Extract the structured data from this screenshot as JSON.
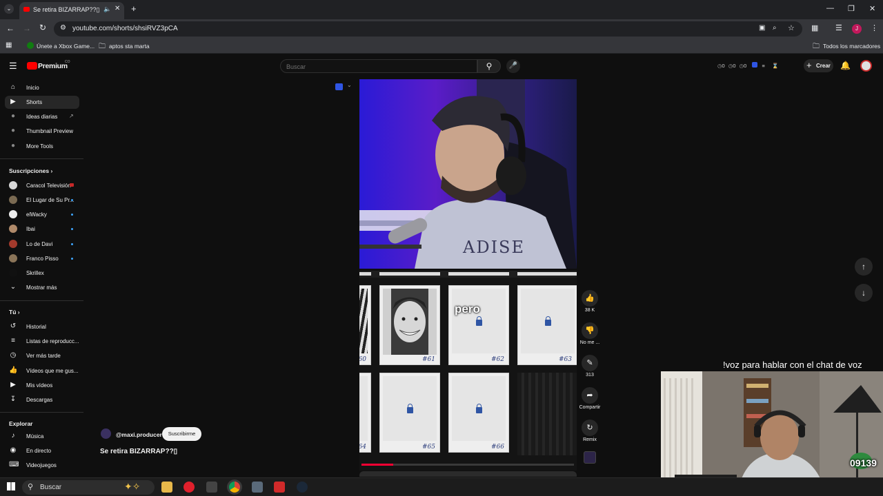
{
  "browser": {
    "tab_title": "Se retira BIZARRAP??▯ - Yo",
    "new_tab": "+",
    "url": "youtube.com/shorts/shsiRVZ3pCA",
    "bookmarks": [
      "Únete a Xbox Game...",
      "aptos sta marta"
    ],
    "all_bookmarks": "Todos los marcadores",
    "profile_initial": "J"
  },
  "youtube": {
    "logo": "Premium",
    "logo_sup": "CO",
    "search_placeholder": "Buscar",
    "create_label": "Crear",
    "stats": [
      "0",
      "0",
      "0"
    ]
  },
  "sidebar": {
    "main": [
      {
        "label": "Inicio",
        "icon": "home-icon"
      },
      {
        "label": "Shorts",
        "icon": "shorts-icon"
      },
      {
        "label": "Ideas diarias",
        "icon": "extension-icon"
      },
      {
        "label": "Thumbnail Preview",
        "icon": "extension-icon"
      },
      {
        "label": "More Tools",
        "icon": "extension-icon"
      }
    ],
    "subs_header": "Suscripciones",
    "subs": [
      {
        "label": "Caracol Televisión",
        "color": "#d8d8d8"
      },
      {
        "label": "El Lugar de Su Pr...",
        "color": "#7a6a52"
      },
      {
        "label": "elWacky",
        "color": "#eeeeee"
      },
      {
        "label": "Ibai",
        "color": "#b08a6a"
      },
      {
        "label": "Lo de Davi",
        "color": "#a33a2c"
      },
      {
        "label": "Franco Pisso",
        "color": "#8a7458"
      },
      {
        "label": "Skrillex",
        "color": "#111111"
      }
    ],
    "show_more": "Mostrar más",
    "you_header": "Tú",
    "you": [
      {
        "label": "Historial",
        "icon": "history-icon"
      },
      {
        "label": "Listas de reproducc...",
        "icon": "playlist-icon"
      },
      {
        "label": "Ver más tarde",
        "icon": "clock-icon"
      },
      {
        "label": "Vídeos que me gus...",
        "icon": "thumb-up-icon"
      },
      {
        "label": "Mis vídeos",
        "icon": "video-icon"
      },
      {
        "label": "Descargas",
        "icon": "download-icon"
      }
    ],
    "explore_header": "Explorar",
    "explore": [
      {
        "label": "Música",
        "icon": "music-icon"
      },
      {
        "label": "En directo",
        "icon": "live-icon"
      },
      {
        "label": "Videojuegos",
        "icon": "gamepad-icon"
      }
    ]
  },
  "short": {
    "channel": "@maxi.producer",
    "subscribe": "Suscribirme",
    "title": "Se retira BIZARRAP??▯",
    "card_numbers": [
      "60",
      "61",
      "62",
      "63",
      "64",
      "65",
      "66"
    ],
    "overlay_word": "pero",
    "progress": 0.15
  },
  "actions": {
    "like_count": "38 K",
    "dislike_label": "No me ...",
    "comments_count": "313",
    "share_label": "Compartir",
    "remix_label": "Remix"
  },
  "stream": {
    "overlay_text": "!voz para hablar con el chat de voz",
    "counter": "09139"
  },
  "taskbar": {
    "search_placeholder": "Buscar"
  }
}
